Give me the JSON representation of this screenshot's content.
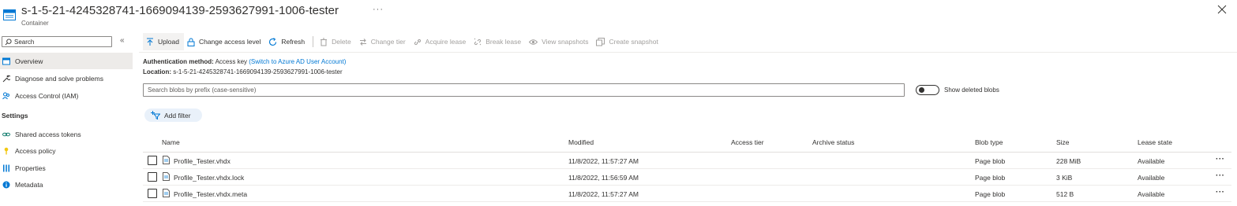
{
  "header": {
    "title": "s-1-5-21-4245328741-1669094139-2593627991-1006-tester",
    "subtitle": "Container",
    "more_label": "···"
  },
  "sidebar": {
    "search_placeholder": "Search",
    "collapse_label": "«",
    "items": [
      {
        "label": "Overview",
        "icon": "container-icon"
      },
      {
        "label": "Diagnose and solve problems",
        "icon": "wrench-icon"
      },
      {
        "label": "Access Control (IAM)",
        "icon": "people-icon"
      }
    ],
    "settings_header": "Settings",
    "settings_items": [
      {
        "label": "Shared access tokens",
        "icon": "link-icon"
      },
      {
        "label": "Access policy",
        "icon": "key-icon"
      },
      {
        "label": "Properties",
        "icon": "sliders-icon"
      },
      {
        "label": "Metadata",
        "icon": "info-icon"
      }
    ]
  },
  "toolbar": {
    "upload": "Upload",
    "change_access": "Change access level",
    "refresh": "Refresh",
    "delete": "Delete",
    "change_tier": "Change tier",
    "acquire_lease": "Acquire lease",
    "break_lease": "Break lease",
    "view_snapshots": "View snapshots",
    "create_snapshot": "Create snapshot"
  },
  "info": {
    "auth_label": "Authentication method:",
    "auth_value": "Access key",
    "auth_link": "(Switch to Azure AD User Account)",
    "location_label": "Location:",
    "location_value": "s-1-5-21-4245328741-1669094139-2593627991-1006-tester"
  },
  "filter": {
    "search_placeholder": "Search blobs by prefix (case-sensitive)",
    "show_deleted_label": "Show deleted blobs",
    "show_deleted": false,
    "add_filter": "Add filter"
  },
  "table": {
    "columns": {
      "name": "Name",
      "modified": "Modified",
      "access_tier": "Access tier",
      "archive_status": "Archive status",
      "blob_type": "Blob type",
      "size": "Size",
      "lease_state": "Lease state"
    },
    "rows": [
      {
        "name": "Profile_Tester.vhdx",
        "modified": "11/8/2022, 11:57:27 AM",
        "access_tier": "",
        "archive_status": "",
        "blob_type": "Page blob",
        "size": "228 MiB",
        "lease_state": "Available"
      },
      {
        "name": "Profile_Tester.vhdx.lock",
        "modified": "11/8/2022, 11:56:59 AM",
        "access_tier": "",
        "archive_status": "",
        "blob_type": "Page blob",
        "size": "3 KiB",
        "lease_state": "Available"
      },
      {
        "name": "Profile_Tester.vhdx.meta",
        "modified": "11/8/2022, 11:57:27 AM",
        "access_tier": "",
        "archive_status": "",
        "blob_type": "Page blob",
        "size": "512 B",
        "lease_state": "Available"
      }
    ],
    "row_more_label": "···"
  },
  "colors": {
    "accent": "#0078d4",
    "text": "#323130",
    "disabled": "#a19f9d",
    "active_nav": "#edebe9"
  }
}
